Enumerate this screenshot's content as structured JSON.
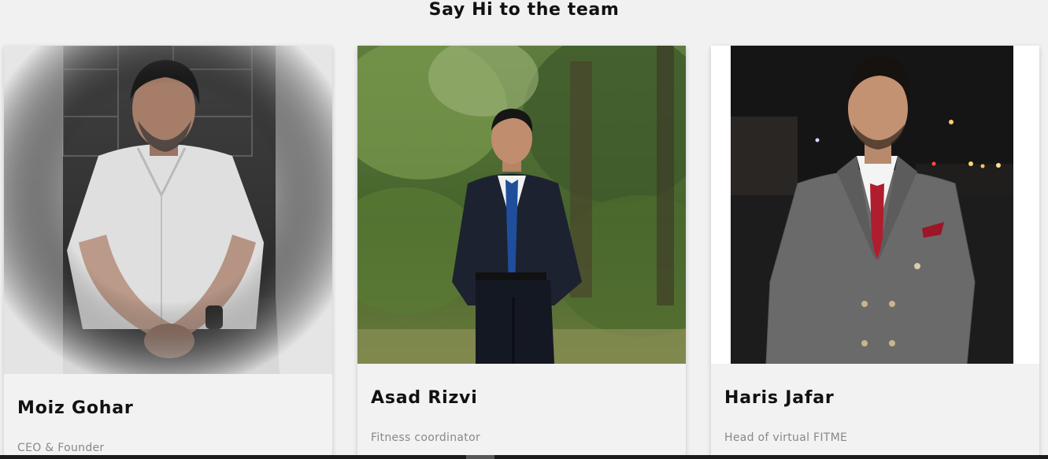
{
  "section": {
    "title": "Say Hi to the team"
  },
  "team": [
    {
      "name": "Moiz Gohar",
      "role": "CEO & Founder",
      "photo": "portrait-photo-moiz-gohar"
    },
    {
      "name": "Asad Rizvi",
      "role": "Fitness coordinator",
      "photo": "portrait-photo-asad-rizvi"
    },
    {
      "name": "Haris Jafar",
      "role": "Head of virtual FITME",
      "photo": "portrait-photo-haris-jafar"
    }
  ],
  "colors": {
    "page_background": "#f1f1f1",
    "card_background": "#f2f2f2",
    "name_text": "#111111",
    "role_text": "#888888"
  }
}
